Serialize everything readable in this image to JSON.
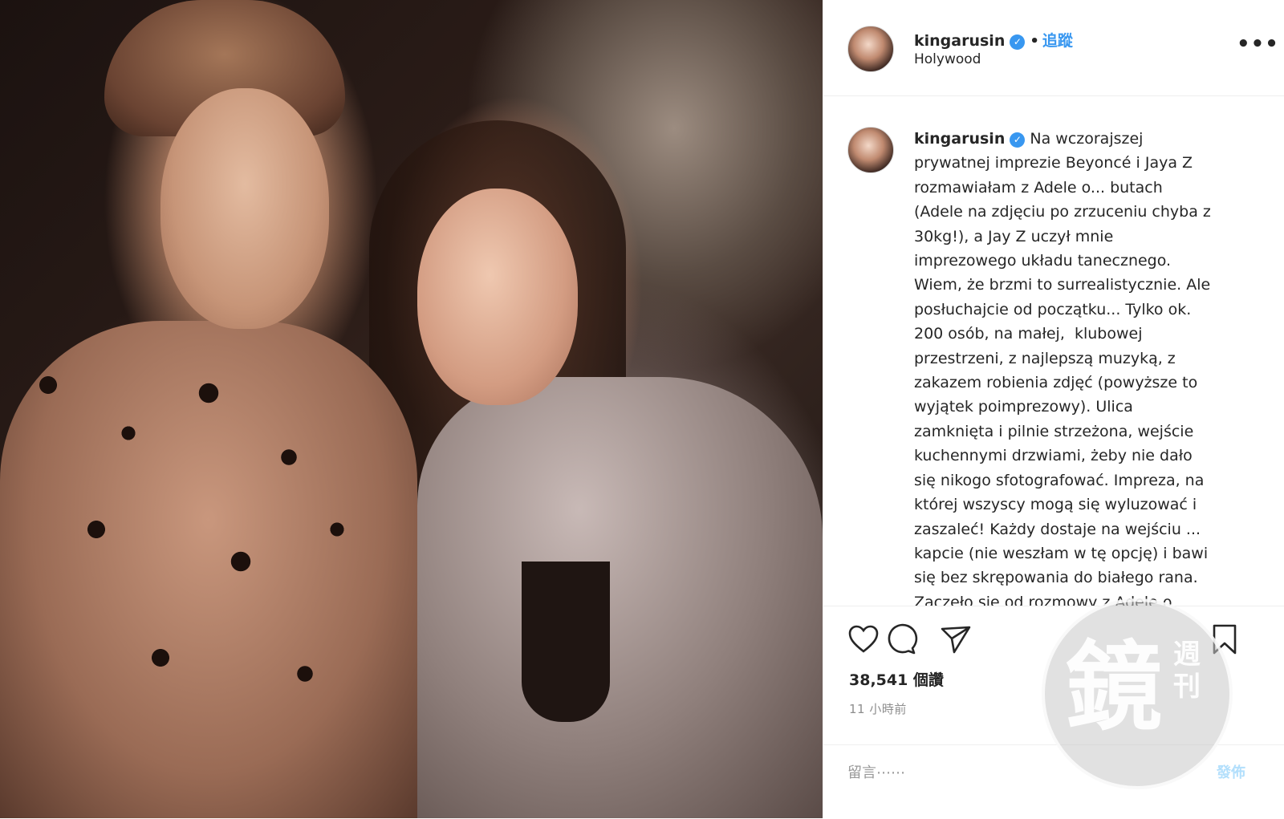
{
  "post": {
    "username": "kingarusin",
    "verified": true,
    "separator": "•",
    "follow_label": "追蹤",
    "location": "Holywood",
    "more_icon": "more-options-icon"
  },
  "caption": {
    "username": "kingarusin",
    "text": "Na wczorajszej\nprywatnej imprezie Beyoncé i Jaya Z\nrozmawiałam z Adele o... butach\n(Adele na zdjęciu po zrzuceniu chyba z\n30kg!), a Jay Z uczył mnie\nimprezowego układu tanecznego.\nWiem, że brzmi to surrealistycznie. Ale\nposłuchajcie od początku... Tylko ok.\n200 osób, na małej,  klubowej\nprzestrzeni, z najlepszą muzyką, z\nzakazem robienia zdjęć (powyższe to\nwyjątek poimprezowy). Ulica\nzamknięta i pilnie strzeżona, wejście\nkuchennymi drzwiami, żeby nie dało\nsię nikogo sfotografować. Impreza, na\nktórej wszyscy mogą się wyluzować i\nzaszaleć! Każdy dostaje na wejściu ...\nkapcie (nie weszłam w tę opcję) i bawi\nsię bez skrępowania do białego rana.\nZaczęło się od rozmowy z Adele o"
  },
  "actions": {
    "icons": [
      "heart-icon",
      "comment-icon",
      "share-icon",
      "bookmark-icon"
    ]
  },
  "stats": {
    "likes": "38,541 個讚",
    "time_ago": "11 小時前"
  },
  "comment_box": {
    "placeholder": "留言⋯⋯",
    "post_label": "發佈"
  },
  "watermark": {
    "big": "鏡",
    "small": "週\n刊"
  },
  "colors": {
    "accent": "#3897f0",
    "text": "#262626",
    "muted": "#8e8e8e",
    "post_disabled": "#b2dffc"
  }
}
